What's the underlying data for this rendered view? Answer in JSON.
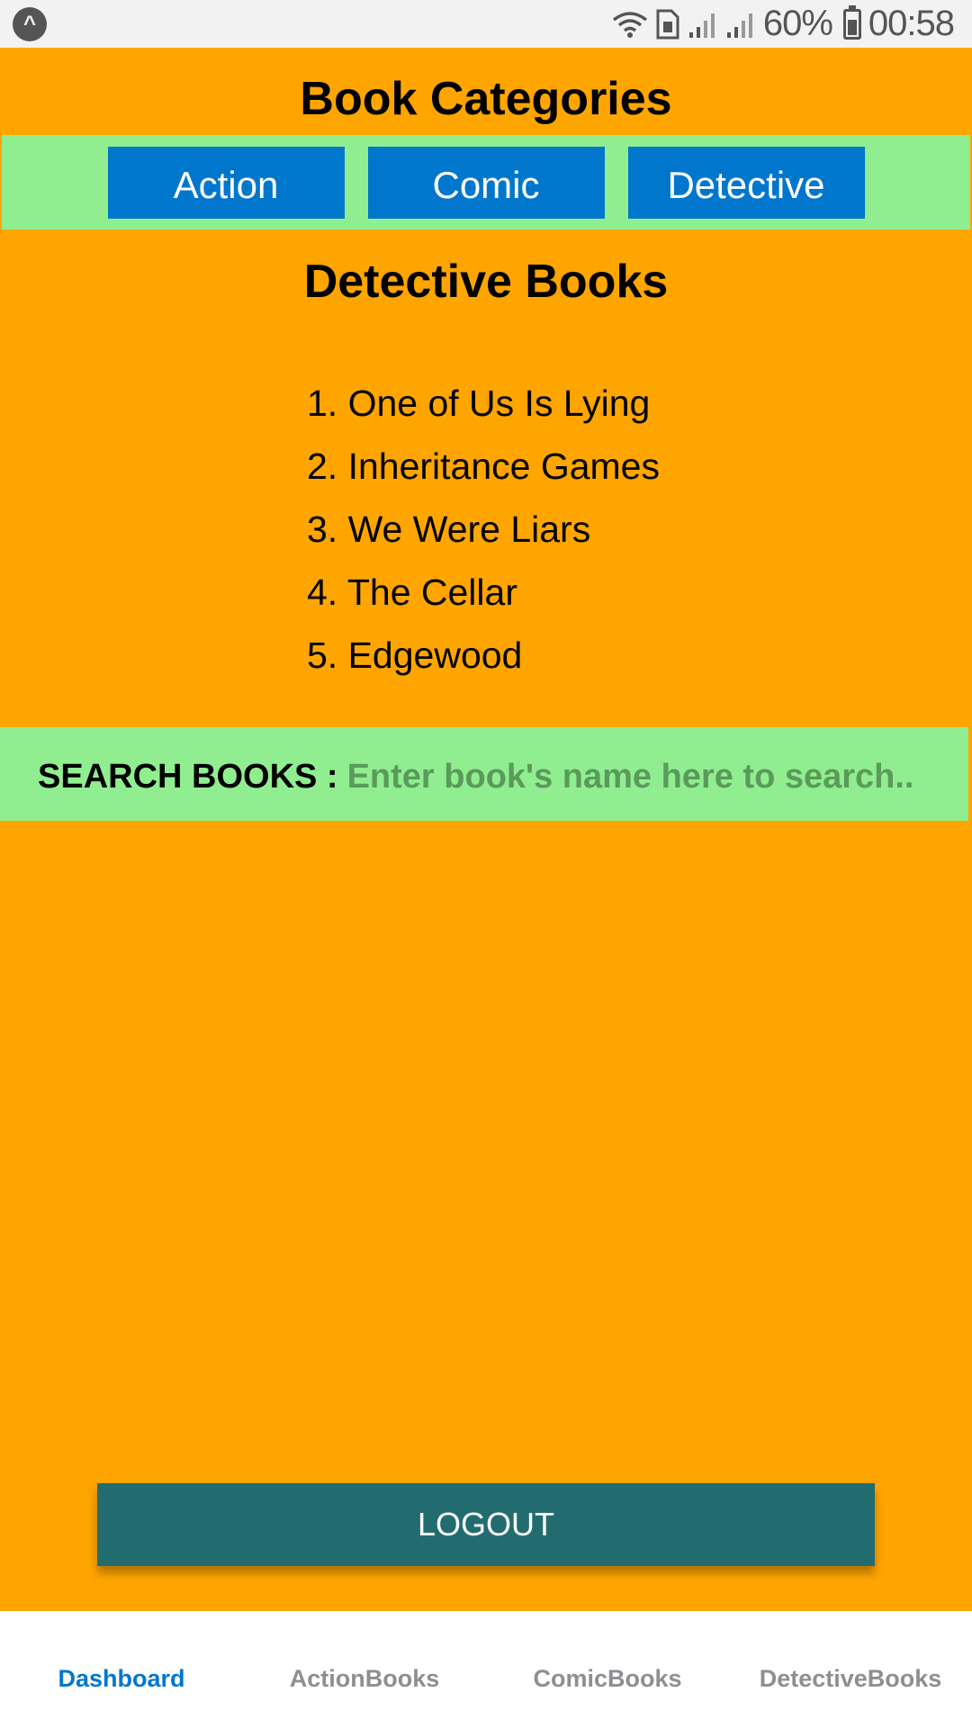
{
  "status_bar": {
    "app_icon": "expo-chevron-icon",
    "battery_percent": "60%",
    "battery_level": 0.6,
    "time": "00:58",
    "icons": [
      "wifi-icon",
      "sim-icon",
      "signal-icon",
      "signal-icon",
      "battery-icon"
    ]
  },
  "header": {
    "title": "Book Categories"
  },
  "categories": [
    {
      "label": "Action"
    },
    {
      "label": "Comic"
    },
    {
      "label": "Detective"
    }
  ],
  "section": {
    "title": "Detective Books",
    "books": [
      "1. One of Us Is Lying",
      "2. Inheritance Games",
      "3. We Were Liars",
      "4. The Cellar",
      "5. Edgewood"
    ]
  },
  "search": {
    "label": "SEARCH BOOKS :",
    "placeholder": "Enter book's name here to search..",
    "value": ""
  },
  "logout": {
    "label": "LOGOUT"
  },
  "tabs": [
    {
      "label": "Dashboard",
      "active": true
    },
    {
      "label": "ActionBooks",
      "active": false
    },
    {
      "label": "ComicBooks",
      "active": false
    },
    {
      "label": "DetectiveBooks",
      "active": false
    }
  ],
  "colors": {
    "background": "#FFA500",
    "category_bar": "#90EE90",
    "category_button": "#0077CC",
    "logout_button": "#226C70",
    "active_tab": "#0077CC",
    "inactive_tab": "#8e8e93"
  }
}
